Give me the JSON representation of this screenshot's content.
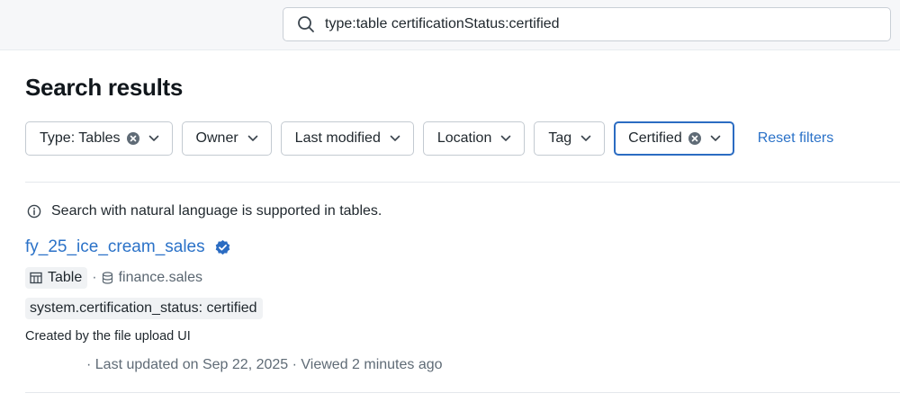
{
  "search": {
    "query": "type:table certificationStatus:certified",
    "icon": "search-icon"
  },
  "page": {
    "title": "Search results"
  },
  "filters": [
    {
      "label": "Type: Tables",
      "active": false,
      "clearable": true
    },
    {
      "label": "Owner",
      "active": false,
      "clearable": false
    },
    {
      "label": "Last modified",
      "active": false,
      "clearable": false
    },
    {
      "label": "Location",
      "active": false,
      "clearable": false
    },
    {
      "label": "Tag",
      "active": false,
      "clearable": false
    },
    {
      "label": "Certified",
      "active": true,
      "clearable": true
    }
  ],
  "reset_label": "Reset filters",
  "info": {
    "text": "Search with natural language is supported in tables."
  },
  "result": {
    "name": "fy_25_ice_cream_sales",
    "type_label": "Table",
    "separator": "·",
    "location": "finance.sales",
    "tag": "system.certification_status: certified",
    "description": "Created by the file upload UI",
    "updated": "· Last updated on Sep 22, 2025 · Viewed 2 minutes ago"
  },
  "colors": {
    "link": "#2b72c8",
    "active_border": "#2b6cc2",
    "verified": "#2b6cc2"
  }
}
